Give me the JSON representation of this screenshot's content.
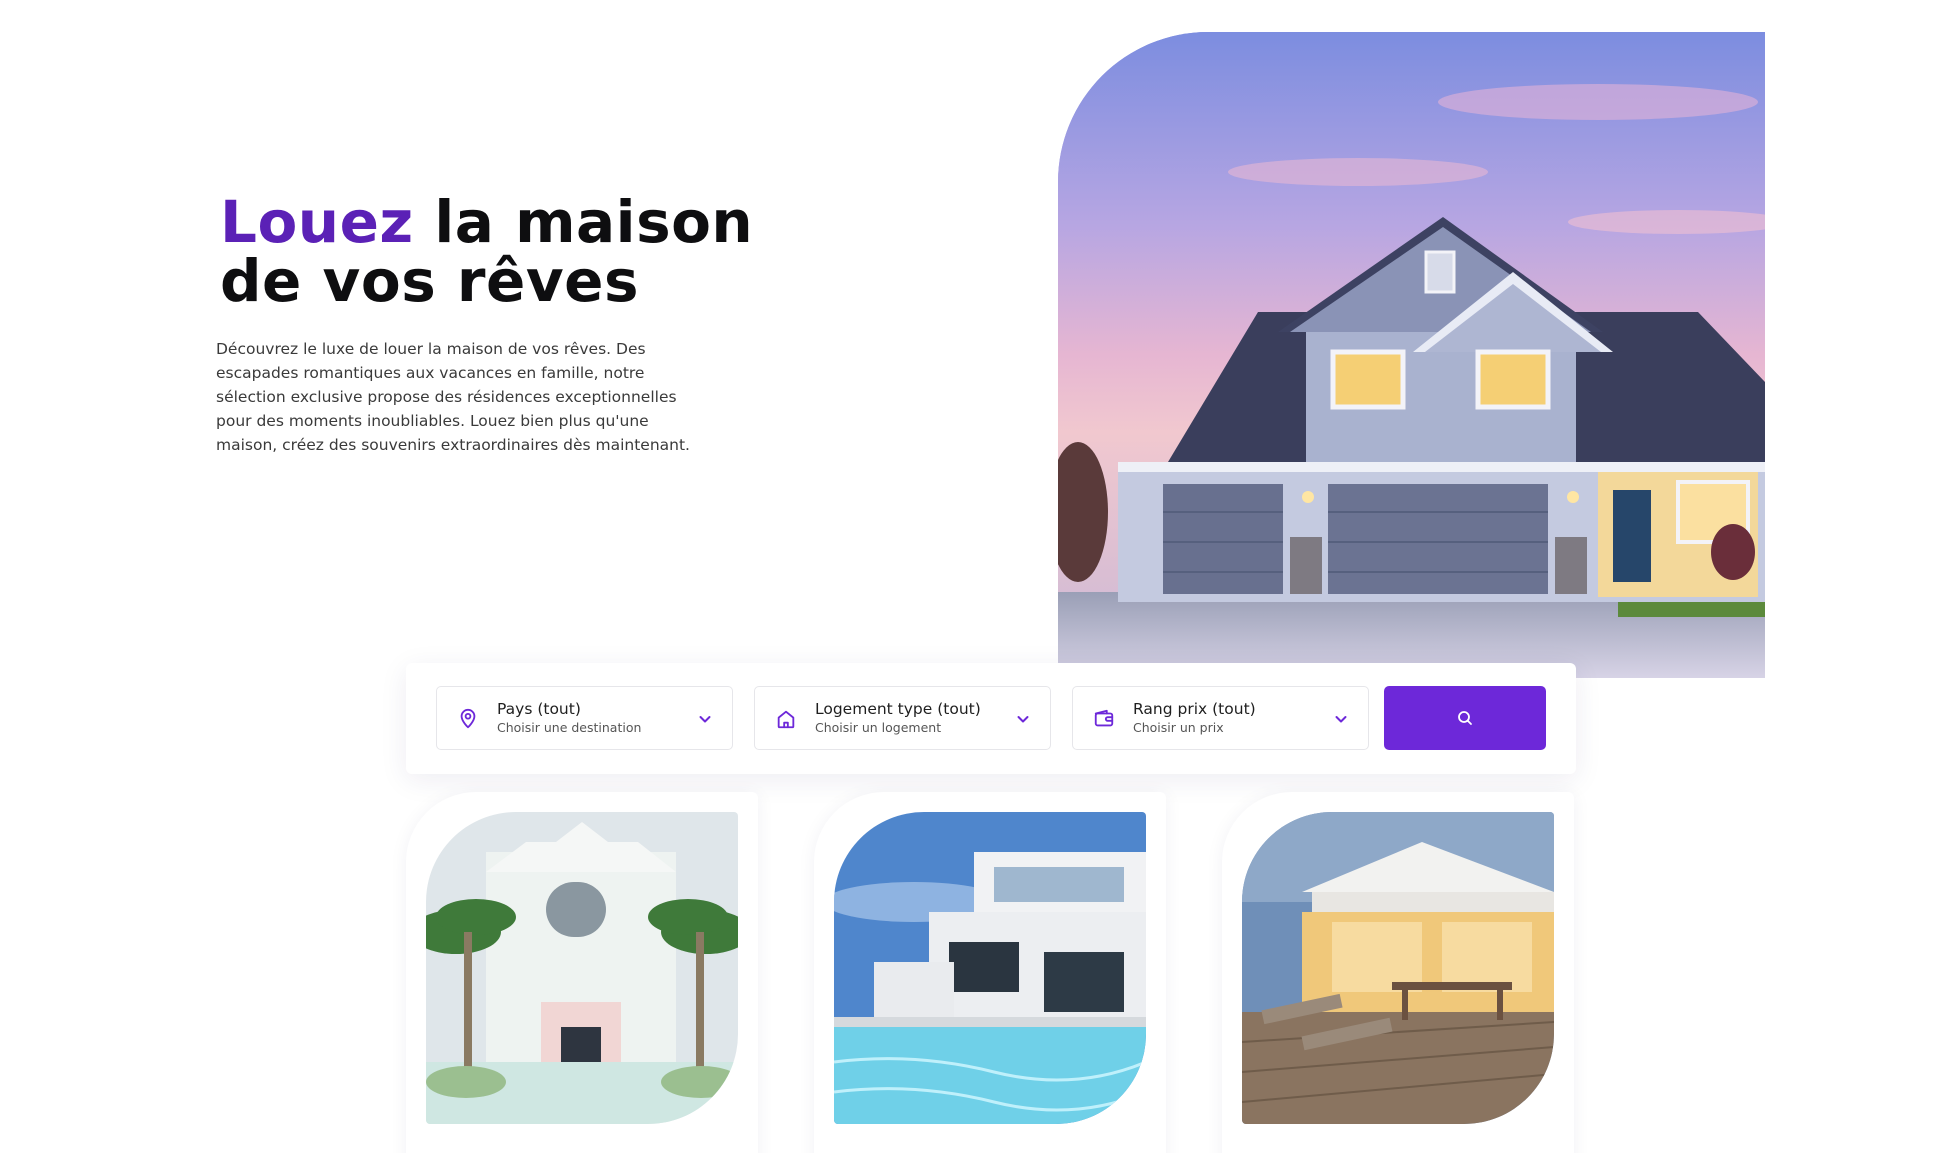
{
  "hero": {
    "title_accent": "Louez",
    "title_rest_line1": " la maison",
    "title_line2": "de vos rêves",
    "description": "Découvrez le luxe de louer la maison de vos rêves. Des escapades romantiques aux vacances en famille, notre sélection exclusive propose des résidences exceptionnelles pour des moments inoubliables. Louez bien plus qu'une maison, créez des souvenirs extraordinaires dès maintenant."
  },
  "search": {
    "filters": [
      {
        "title": "Pays (tout)",
        "subtitle": "Choisir une destination",
        "icon": "map-pin-icon"
      },
      {
        "title": "Logement type (tout)",
        "subtitle": "Choisir un logement",
        "icon": "home-icon"
      },
      {
        "title": "Rang prix (tout)",
        "subtitle": "Choisir un prix",
        "icon": "wallet-icon"
      }
    ],
    "button_icon": "search-icon"
  },
  "colors": {
    "accent": "#5b21b6",
    "button": "#6d28d9",
    "icon": "#6d28d9"
  },
  "cards": [
    {
      "image": "white-villa-with-palm-trees"
    },
    {
      "image": "modern-house-with-pool"
    },
    {
      "image": "beach-house-terrace-at-dusk"
    }
  ]
}
